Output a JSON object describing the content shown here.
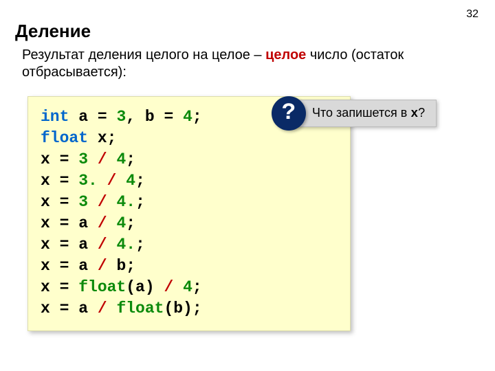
{
  "page_number": "32",
  "title": "Деление",
  "description": {
    "before": "Результат деления целого на целое – ",
    "em": "целое",
    "after": " число (остаток отбрасывается):"
  },
  "callout": {
    "mark": "?",
    "text_before": " Что запишется в ",
    "text_var": "x",
    "text_after": "?"
  },
  "code": {
    "l1_int": "int",
    "l1_a": " a = ",
    "l1_3": "3",
    "l1_c": ", b = ",
    "l1_4": "4",
    "l1_s": ";",
    "l2_float": "float",
    "l2_x": " x;",
    "l3_x": "x = ",
    "l3_a": "3",
    "l3_op": " / ",
    "l3_b": "4",
    "l3_s": ";",
    "l4_x": "x = ",
    "l4_a": "3.",
    "l4_op": " / ",
    "l4_b": "4",
    "l4_s": ";",
    "l5_x": "x = ",
    "l5_a": "3",
    "l5_op": " / ",
    "l5_b": "4.",
    "l5_s": ";",
    "l6_x": "x = a ",
    "l6_op": "/ ",
    "l6_b": "4",
    "l6_s": ";",
    "l7_x": "x = a ",
    "l7_op": "/ ",
    "l7_b": "4.",
    "l7_s": ";",
    "l8_x": "x = a ",
    "l8_op": "/",
    "l8_b": " b;",
    "l9_x": "x = ",
    "l9_cast": "float",
    "l9_a": "(a) ",
    "l9_op": "/ ",
    "l9_b": "4",
    "l9_s": ";",
    "l10_x": "x = a ",
    "l10_op": "/ ",
    "l10_cast": "float",
    "l10_b": "(b);"
  }
}
